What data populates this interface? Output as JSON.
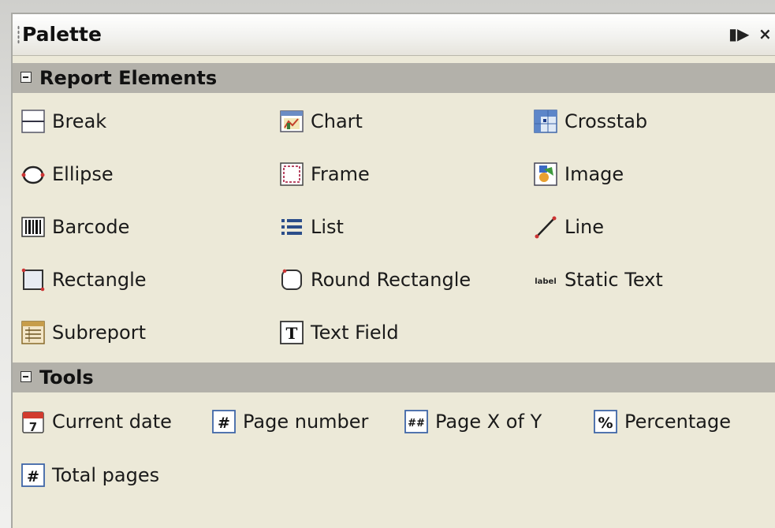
{
  "palette": {
    "title": "Palette",
    "pin_symbol": "▮▶",
    "close_symbol": "×",
    "sections": [
      {
        "label": "Report Elements",
        "items": [
          {
            "label": "Break",
            "icon": "break-icon"
          },
          {
            "label": "Chart",
            "icon": "chart-icon"
          },
          {
            "label": "Crosstab",
            "icon": "crosstab-icon"
          },
          {
            "label": "Ellipse",
            "icon": "ellipse-icon"
          },
          {
            "label": "Frame",
            "icon": "frame-icon"
          },
          {
            "label": "Image",
            "icon": "image-icon"
          },
          {
            "label": "Barcode",
            "icon": "barcode-icon"
          },
          {
            "label": "List",
            "icon": "list-icon"
          },
          {
            "label": "Line",
            "icon": "line-icon"
          },
          {
            "label": "Rectangle",
            "icon": "rectangle-icon"
          },
          {
            "label": "Round Rectangle",
            "icon": "round-rectangle-icon"
          },
          {
            "label": "Static Text",
            "icon": "static-text-icon"
          },
          {
            "label": "Subreport",
            "icon": "subreport-icon"
          },
          {
            "label": "Text Field",
            "icon": "text-field-icon"
          }
        ]
      },
      {
        "label": "Tools",
        "items": [
          {
            "label": "Current date",
            "icon": "calendar-icon"
          },
          {
            "label": "Page number",
            "icon": "page-number-icon"
          },
          {
            "label": "Page X of Y",
            "icon": "page-x-of-y-icon"
          },
          {
            "label": "Percentage",
            "icon": "percentage-icon"
          },
          {
            "label": "Total pages",
            "icon": "total-pages-icon"
          }
        ]
      }
    ],
    "icon_text": {
      "calendar": "7",
      "hash": "#",
      "double_hash": "##",
      "percent": "%",
      "text_field": "T",
      "static_label": "label"
    }
  }
}
